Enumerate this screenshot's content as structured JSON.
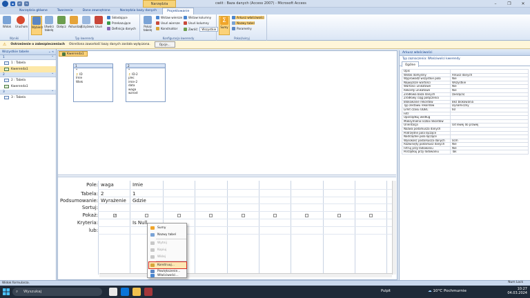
{
  "window": {
    "title": "cwiit : Baza danych (Access 2007) - Microsoft Access",
    "context_tab_title": "Narzędzia kwerend",
    "qat_buttons": [
      "save",
      "undo",
      "redo"
    ]
  },
  "tabs": [
    "Narzędzia główne",
    "Tworzenie",
    "Dane zewnętrzne",
    "Narzędzia bazy danych",
    "Projektowanie"
  ],
  "ribbon": {
    "groups": {
      "results": {
        "label": "Wyniki",
        "buttons": [
          "Widok",
          "Uruchom"
        ]
      },
      "query_type": {
        "label": "Typ kwerendy",
        "buttons": [
          "Wybierz",
          "Utwórz tabelę",
          "Dołącz",
          "Aktualizuj",
          "Krzyżowa",
          "Usuń"
        ],
        "small": [
          "Składające",
          "Przekazujące",
          "Definicja danych"
        ]
      },
      "setup": {
        "label": "Konfiguracja kwerendy",
        "big": "Pokaż tabelę",
        "small": [
          "Wstaw wiersze",
          "Usuń wiersze",
          "Konstruktor",
          "Wstaw kolumny",
          "Usuń kolumny",
          "Zwróć:"
        ],
        "return_value": "Wszystkie"
      },
      "showhide": {
        "label": "Pokaż/ukryj",
        "big": "Sumy",
        "small": [
          "Arkusz właściwości",
          "Nazwy tabel",
          "Parametry"
        ]
      }
    }
  },
  "security_bar": {
    "title": "Ostrzeżenie o zabezpieczeniach",
    "message": "Określona zawartość bazy danych została wyłączona.",
    "button": "Opcje..."
  },
  "nav": {
    "header": "Wszystkie tabele",
    "groups": [
      {
        "name": "1",
        "items": [
          "1 : Tabela",
          "Kwerenda1"
        ]
      },
      {
        "name": "2",
        "items": [
          "2 : Tabela",
          "Kwerenda1"
        ]
      },
      {
        "name": "3",
        "items": [
          "3 : Tabela"
        ]
      }
    ]
  },
  "query": {
    "tab_label": "Kwerenda1",
    "tables": [
      {
        "title": "1",
        "fields": [
          "*",
          "ID",
          "Imie",
          "Wiek"
        ]
      },
      {
        "title": "2",
        "fields": [
          "*",
          "ID-2",
          "plec",
          "imie-2",
          "data",
          "waga",
          "wzrost"
        ]
      }
    ],
    "row_labels": [
      "Pole:",
      "Tabela:",
      "Podsumowanie:",
      "Sortuj:",
      "Pokaż:",
      "Kryteria:",
      "lub:"
    ],
    "columns": [
      {
        "field": "waga",
        "table": "2",
        "total": "Wyrażenie",
        "show": true,
        "criteria": ""
      },
      {
        "field": "Imie",
        "table": "1",
        "total": "Gdzie",
        "show": false,
        "criteria": "Is Null"
      }
    ]
  },
  "context_menu": {
    "items": [
      {
        "label": "Sumy",
        "disabled": false
      },
      {
        "label": "Nazwy tabel",
        "disabled": false
      },
      {
        "label": "Wytnij",
        "disabled": true
      },
      {
        "label": "Kopiuj",
        "disabled": true
      },
      {
        "label": "Wklej",
        "disabled": true
      },
      {
        "label": "Konstruuj...",
        "disabled": false,
        "highlighted": true
      },
      {
        "label": "Powiększenie...",
        "disabled": false
      },
      {
        "label": "Właściwości...",
        "disabled": false
      }
    ]
  },
  "property_sheet": {
    "title": "Arkusz właściwości",
    "selection_type": "Typ zaznaczenia: Właściwości kwerendy",
    "tab": "Ogólne",
    "rows": [
      [
        "Opis",
        ""
      ],
      [
        "Widok domyślny",
        "Arkusz danych"
      ],
      [
        "Wyprowadź wszystkie pola",
        "Nie"
      ],
      [
        "Najwyższe wartości",
        "Wszystkie"
      ],
      [
        "Wartości unikatowe",
        "Nie"
      ],
      [
        "Rekordy unikatowe",
        "Nie"
      ],
      [
        "Źródłowa baza danych",
        "(bieżąca)"
      ],
      [
        "Źródłowy ciąg połączenia",
        ""
      ],
      [
        "Blokowanie rekordów",
        "Bez blokowania"
      ],
      [
        "Typ zestawu rekordów",
        "Dynamiczny"
      ],
      [
        "Limit czasu ODBC",
        "60"
      ],
      [
        "Filtr",
        ""
      ],
      [
        "Uporządkuj według",
        ""
      ],
      [
        "Maksymalna liczba rekordów",
        ""
      ],
      [
        "Orientacja",
        "Od lewej do prawej"
      ],
      [
        "Nazwa podarkusza danych",
        ""
      ],
      [
        "Podrzędne pola łączące",
        ""
      ],
      [
        "Nadrzędne pola łączące",
        ""
      ],
      [
        "Wysokość podarkusza danych",
        "0cm"
      ],
      [
        "Rozwinięty podarkusz danych",
        "Nie"
      ],
      [
        "Filtruj przy ładowaniu",
        "Nie"
      ],
      [
        "Porządkuj przy ładowaniu",
        "Tak"
      ]
    ]
  },
  "status": {
    "left": "Widok formularza.",
    "right": "Num Lock"
  },
  "taskbar": {
    "search_placeholder": "Wyszukaj",
    "weather": "10°C  Pochmurnie",
    "tray_lang": "Pulpit",
    "time": "10:27",
    "date": "04.03.2024"
  },
  "colors": {
    "accent": "#15428b",
    "context_tab": "#f6d37a",
    "highlight_border": "#d6261f"
  }
}
